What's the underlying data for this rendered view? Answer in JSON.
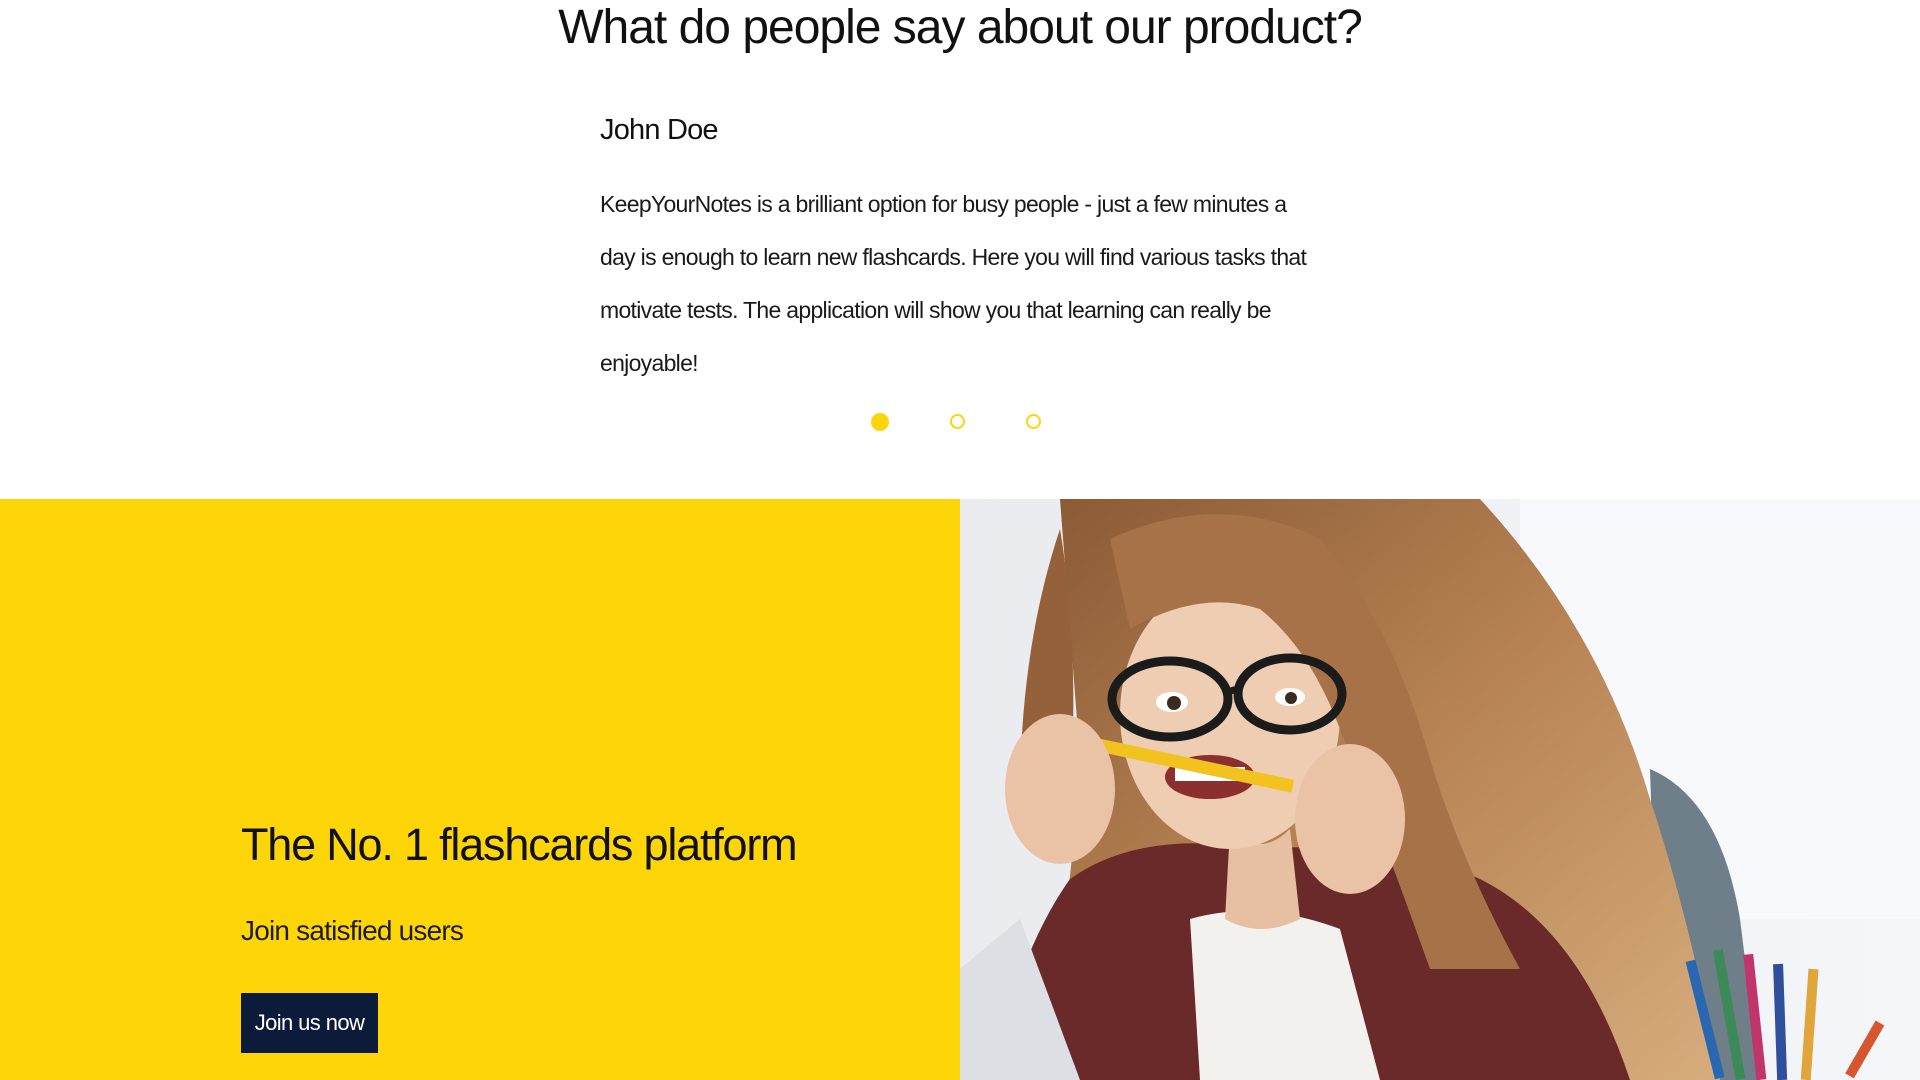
{
  "testimonials": {
    "heading": "What do people say about our product?",
    "author": "John Doe",
    "quote": "KeepYourNotes is a brilliant option for busy people - just a few minutes a day is enough to learn new flashcards. Here you will find various tasks that motivate tests. The application will show you that learning can really be enjoyable!",
    "carousel": {
      "slides": 3,
      "active_index": 0
    }
  },
  "cta": {
    "title": "The No. 1 flashcards platform",
    "subtitle": "Join satisfied users",
    "button_label": "Join us now"
  },
  "photo": {
    "subject": "woman-with-glasses-biting-pencil"
  },
  "colors": {
    "accent_yellow": "#fdd508",
    "button_navy": "#0c1b3a",
    "text_dark": "#111111",
    "background": "#ffffff"
  }
}
